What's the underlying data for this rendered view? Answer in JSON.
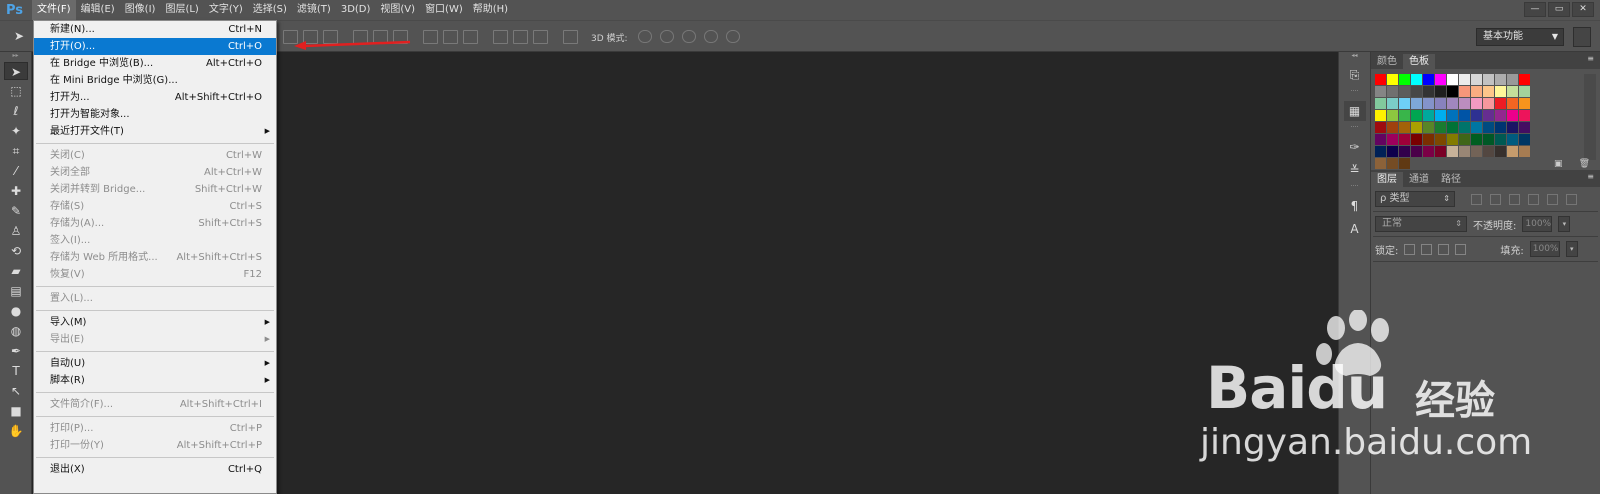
{
  "app": {
    "logo": "Ps",
    "menu": [
      "文件(F)",
      "编辑(E)",
      "图像(I)",
      "图层(L)",
      "文字(Y)",
      "选择(S)",
      "滤镜(T)",
      "3D(D)",
      "视图(V)",
      "窗口(W)",
      "帮助(H)"
    ],
    "active_menu_index": 0,
    "window_controls": [
      "—",
      "▭",
      "✕"
    ]
  },
  "options_bar": {
    "mode3d_label": "3D 模式:",
    "workspace": "基本功能"
  },
  "file_menu": {
    "groups": [
      [
        {
          "label": "新建(N)...",
          "shortcut": "Ctrl+N",
          "disabled": false
        },
        {
          "label": "打开(O)...",
          "shortcut": "Ctrl+O",
          "disabled": false,
          "highlight": true
        },
        {
          "label": "在 Bridge 中浏览(B)...",
          "shortcut": "Alt+Ctrl+O",
          "disabled": false
        },
        {
          "label": "在 Mini Bridge 中浏览(G)...",
          "shortcut": "",
          "disabled": false
        },
        {
          "label": "打开为...",
          "shortcut": "Alt+Shift+Ctrl+O",
          "disabled": false
        },
        {
          "label": "打开为智能对象...",
          "shortcut": "",
          "disabled": false
        },
        {
          "label": "最近打开文件(T)",
          "shortcut": "",
          "disabled": false,
          "submenu": true
        }
      ],
      [
        {
          "label": "关闭(C)",
          "shortcut": "Ctrl+W",
          "disabled": true
        },
        {
          "label": "关闭全部",
          "shortcut": "Alt+Ctrl+W",
          "disabled": true
        },
        {
          "label": "关闭并转到 Bridge...",
          "shortcut": "Shift+Ctrl+W",
          "disabled": true
        },
        {
          "label": "存储(S)",
          "shortcut": "Ctrl+S",
          "disabled": true
        },
        {
          "label": "存储为(A)...",
          "shortcut": "Shift+Ctrl+S",
          "disabled": true
        },
        {
          "label": "签入(I)...",
          "shortcut": "",
          "disabled": true
        },
        {
          "label": "存储为 Web 所用格式...",
          "shortcut": "Alt+Shift+Ctrl+S",
          "disabled": true
        },
        {
          "label": "恢复(V)",
          "shortcut": "F12",
          "disabled": true
        }
      ],
      [
        {
          "label": "置入(L)...",
          "shortcut": "",
          "disabled": true
        }
      ],
      [
        {
          "label": "导入(M)",
          "shortcut": "",
          "disabled": false,
          "submenu": true
        },
        {
          "label": "导出(E)",
          "shortcut": "",
          "disabled": true,
          "submenu": true
        }
      ],
      [
        {
          "label": "自动(U)",
          "shortcut": "",
          "disabled": false,
          "submenu": true
        },
        {
          "label": "脚本(R)",
          "shortcut": "",
          "disabled": false,
          "submenu": true
        }
      ],
      [
        {
          "label": "文件简介(F)...",
          "shortcut": "Alt+Shift+Ctrl+I",
          "disabled": true
        }
      ],
      [
        {
          "label": "打印(P)...",
          "shortcut": "Ctrl+P",
          "disabled": true
        },
        {
          "label": "打印一份(Y)",
          "shortcut": "Alt+Shift+Ctrl+P",
          "disabled": true
        }
      ],
      [
        {
          "label": "退出(X)",
          "shortcut": "Ctrl+Q",
          "disabled": false
        }
      ]
    ]
  },
  "swatch_panel": {
    "tabs": [
      "颜色",
      "色板"
    ],
    "active_tab": 1,
    "colors": [
      "#ff0000",
      "#ffff00",
      "#00ff00",
      "#00ffff",
      "#0000ff",
      "#ff00ff",
      "#ffffff",
      "#ebebeb",
      "#d6d6d6",
      "#c2c2c2",
      "#adadad",
      "#999999",
      "#ff0000",
      "#858585",
      "#707070",
      "#5c5c5c",
      "#474747",
      "#333333",
      "#1f1f1f",
      "#000000",
      "#f7977a",
      "#f9ad81",
      "#fdc68a",
      "#fff79a",
      "#c4df9b",
      "#a3d39c",
      "#82ca9d",
      "#7bcdc8",
      "#6ecff6",
      "#7ea7d8",
      "#8493ca",
      "#8882be",
      "#a187be",
      "#bc8dbf",
      "#f49ac2",
      "#f6989d",
      "#ed1c24",
      "#f26522",
      "#f7941d",
      "#fff200",
      "#8dc73f",
      "#39b54a",
      "#00a651",
      "#00a99d",
      "#00aeef",
      "#0072bc",
      "#0054a6",
      "#2e3192",
      "#662d91",
      "#92278f",
      "#ec008c",
      "#ed145b",
      "#9e0b0f",
      "#a0410d",
      "#a36209",
      "#aba000",
      "#598527",
      "#1a7b30",
      "#007236",
      "#00746b",
      "#0076a3",
      "#004b80",
      "#003471",
      "#1b1464",
      "#440e62",
      "#630460",
      "#9e005d",
      "#9e0039",
      "#790000",
      "#7b2e00",
      "#7d4900",
      "#827b00",
      "#406618",
      "#005e20",
      "#005826",
      "#005952",
      "#005b7f",
      "#003663",
      "#002157",
      "#0d004c",
      "#32004b",
      "#4b0049",
      "#7b0046",
      "#7a0026",
      "#c7b299",
      "#998675",
      "#736357",
      "#534741",
      "#37302d",
      "#c69c6d",
      "#a67c52",
      "#8c6239",
      "#754c24",
      "#603913"
    ],
    "footer": [
      "▣",
      "🗑"
    ]
  },
  "layers_panel": {
    "tabs": [
      "图层",
      "通道",
      "路径"
    ],
    "active_tab": 0,
    "kind": "ρ 类型",
    "blend_mode": "正常",
    "opacity_label": "不透明度:",
    "opacity_value": "100%",
    "lock_label": "锁定:",
    "fill_label": "填充:",
    "fill_value": "100%"
  },
  "watermark": {
    "brand": "Bai",
    "brand_tail": "du",
    "product": "经验",
    "url": "jingyan.baidu.com"
  }
}
